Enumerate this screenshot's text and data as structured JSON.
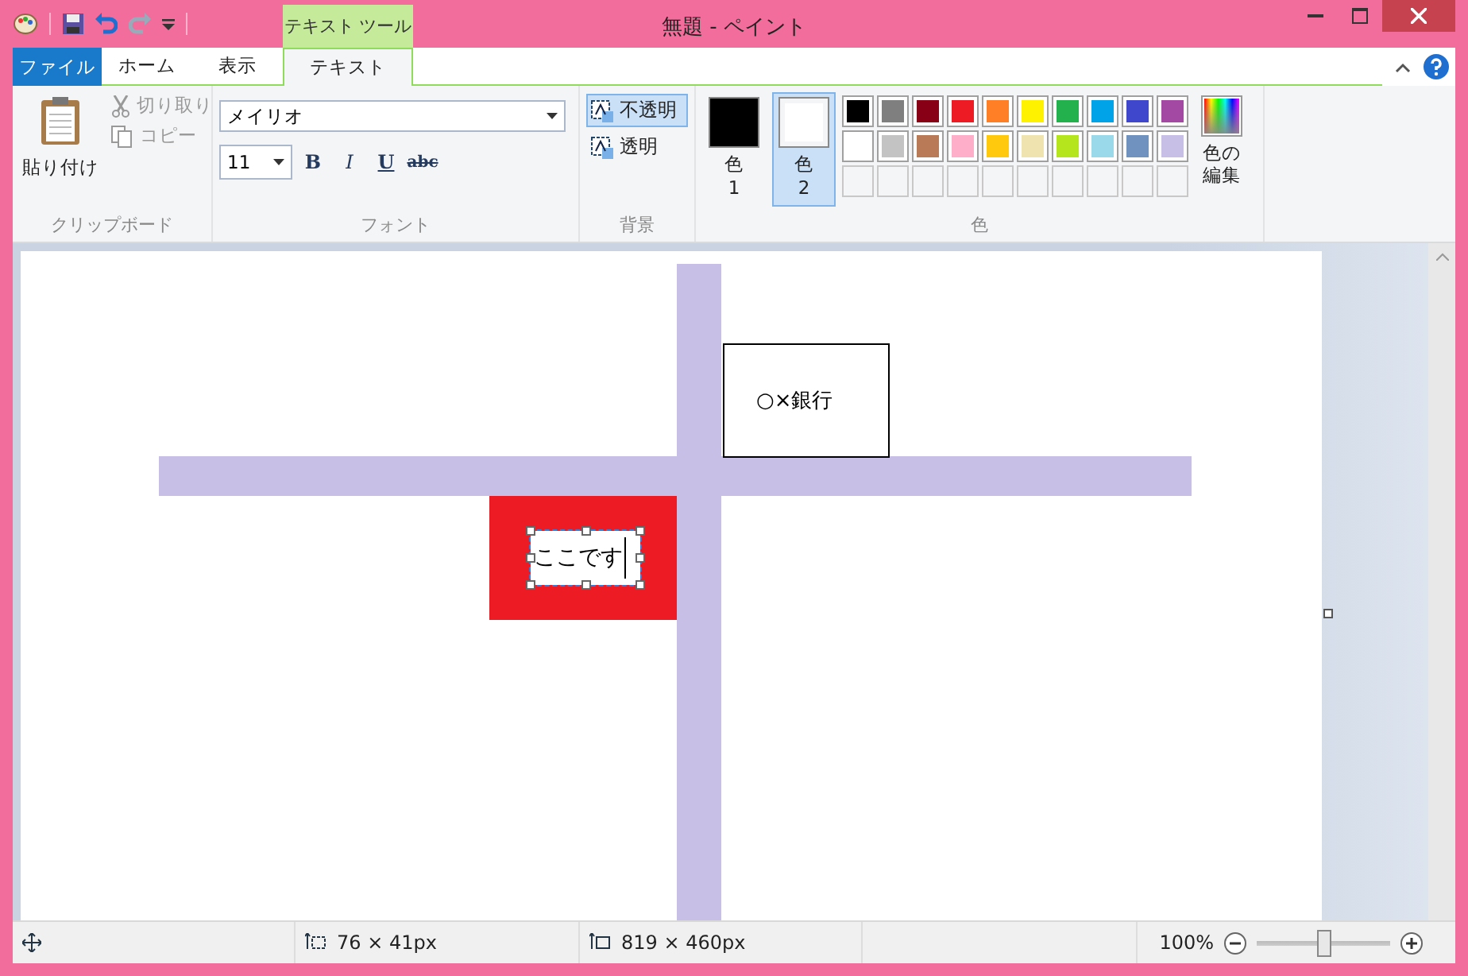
{
  "window": {
    "title": "無題 - ペイント"
  },
  "context_tab": {
    "label": "テキスト ツール"
  },
  "tabs": [
    {
      "label": "ファイル",
      "selected": false,
      "kind": "file"
    },
    {
      "label": "ホーム",
      "selected": false,
      "kind": "normal"
    },
    {
      "label": "表示",
      "selected": false,
      "kind": "normal"
    },
    {
      "label": "テキスト",
      "selected": true,
      "kind": "context"
    }
  ],
  "clipboard": {
    "paste": "貼り付け",
    "cut": {
      "label": "切り取り",
      "disabled": true
    },
    "copy": {
      "label": "コピー",
      "disabled": true
    },
    "group_label": "クリップボード"
  },
  "font": {
    "family": "メイリオ",
    "size": "11",
    "bold": "B",
    "italic": "I",
    "underline": "U",
    "strike": "abc",
    "group_label": "フォント"
  },
  "background": {
    "options": [
      {
        "label": "不透明",
        "selected": true
      },
      {
        "label": "透明",
        "selected": false
      }
    ],
    "group_label": "背景"
  },
  "colors": {
    "color1": {
      "label": "色",
      "number": "1",
      "selected": false
    },
    "color2": {
      "label": "色",
      "number": "2",
      "selected": true
    },
    "edit": "色の編集",
    "group_label": "色",
    "palette": [
      {
        "color": "#000000"
      },
      {
        "color": "#7f7f7f"
      },
      {
        "color": "#880015"
      },
      {
        "color": "#ed1c24"
      },
      {
        "color": "#ff7f27"
      },
      {
        "color": "#fff200"
      },
      {
        "color": "#22b14c"
      },
      {
        "color": "#00a2e8"
      },
      {
        "color": "#3f48cc"
      },
      {
        "color": "#a349a4"
      },
      {
        "color": "#ffffff"
      },
      {
        "color": "#c3c3c3"
      },
      {
        "color": "#b97a57"
      },
      {
        "color": "#ffaec9"
      },
      {
        "color": "#ffc90e"
      },
      {
        "color": "#efe4b0"
      },
      {
        "color": "#b5e61d"
      },
      {
        "color": "#99d9ea"
      },
      {
        "color": "#7092be"
      },
      {
        "color": "#c8bfe7"
      },
      {
        "kind": "empty"
      },
      {
        "kind": "empty"
      },
      {
        "kind": "empty"
      },
      {
        "kind": "empty"
      },
      {
        "kind": "empty"
      },
      {
        "kind": "empty"
      },
      {
        "kind": "empty"
      },
      {
        "kind": "empty"
      },
      {
        "kind": "empty"
      },
      {
        "kind": "empty"
      }
    ]
  },
  "canvas": {
    "bank_label": "○×銀行",
    "text_box": "ここです"
  },
  "status_bar": {
    "selection_size": "76 × 41px",
    "image_size": "819 × 460px",
    "zoom": "100%",
    "zoom_slider": {
      "level": 0.5
    }
  }
}
